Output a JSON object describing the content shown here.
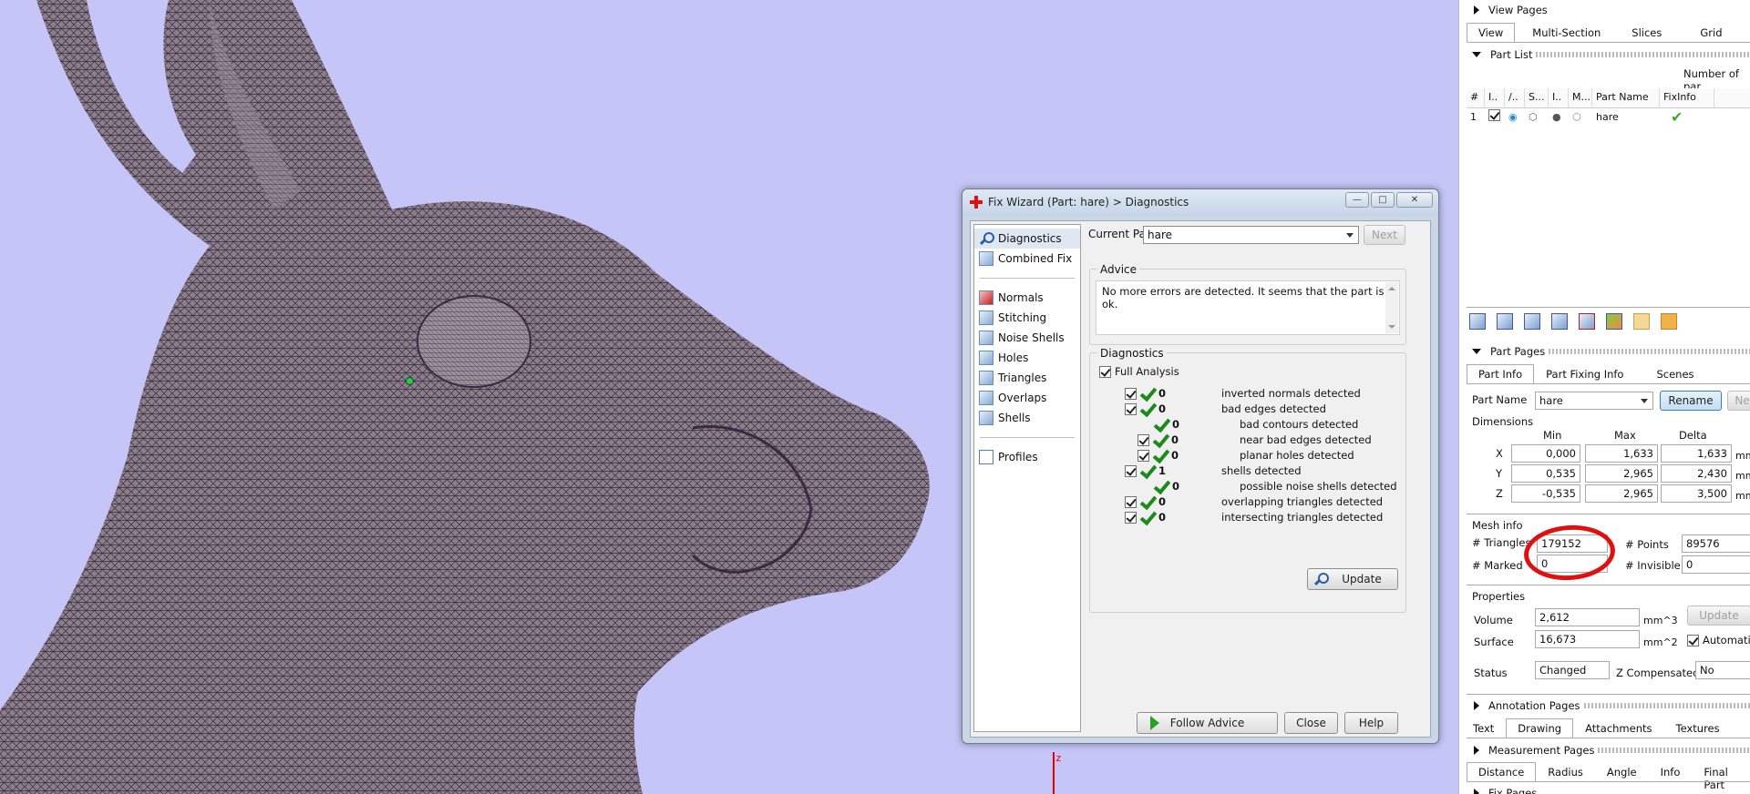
{
  "viewport": {
    "axis_label": "z"
  },
  "fix_wizard": {
    "title": "Fix Wizard (Part: hare) > Diagnostics",
    "window_buttons": {
      "minimize": "—",
      "maximize": "□",
      "close": "✕"
    },
    "nav": {
      "group1": [
        "Diagnostics",
        "Combined Fix"
      ],
      "group2": [
        "Normals",
        "Stitching",
        "Noise Shells",
        "Holes",
        "Triangles",
        "Overlaps",
        "Shells"
      ],
      "group3": [
        "Profiles"
      ]
    },
    "current_part_label": "Current Part:",
    "current_part_value": "hare",
    "next_button": "Next",
    "advice_title": "Advice",
    "advice_text": "No more errors are detected. It seems that the part is ok.",
    "diagnostics_title": "Diagnostics",
    "full_analysis_label": "Full Analysis",
    "diagnostics": [
      {
        "count": "0",
        "label": "inverted normals detected"
      },
      {
        "count": "0",
        "label": "bad edges detected"
      },
      {
        "count": "0",
        "label": "bad contours detected"
      },
      {
        "count": "0",
        "label": "near bad edges detected"
      },
      {
        "count": "0",
        "label": "planar holes detected"
      },
      {
        "count": "1",
        "label": "shells detected"
      },
      {
        "count": "0",
        "label": "possible noise shells detected"
      },
      {
        "count": "0",
        "label": "overlapping triangles detected"
      },
      {
        "count": "0",
        "label": "intersecting triangles detected"
      }
    ],
    "update_button": "Update",
    "follow_advice_button": "Follow Advice",
    "close_button": "Close",
    "help_button": "Help"
  },
  "right_panel": {
    "view_pages": {
      "header": "View Pages",
      "tabs": [
        "View",
        "Multi-Section",
        "Slices",
        "Grid"
      ]
    },
    "part_list": {
      "header": "Part List",
      "number_of_parts_label": "Number of par",
      "columns": [
        "#",
        "I..",
        "/..",
        "S...",
        "I..",
        "M...",
        "Part Name",
        "FixInfo"
      ],
      "row": {
        "index": "1",
        "name": "hare",
        "fixinfo": "✔"
      }
    },
    "part_pages": {
      "header": "Part Pages",
      "tabs": [
        "Part Info",
        "Part Fixing Info",
        "Scenes"
      ],
      "part_name_label": "Part Name",
      "part_name_value": "hare",
      "rename_button": "Rename",
      "next_button": "Nex",
      "dimensions_title": "Dimensions",
      "dim_headers": [
        "Min",
        "Max",
        "Delta"
      ],
      "dims": [
        {
          "axis": "X",
          "min": "0,000",
          "max": "1,633",
          "delta": "1,633",
          "unit": "mm"
        },
        {
          "axis": "Y",
          "min": "0,535",
          "max": "2,965",
          "delta": "2,430",
          "unit": "mm"
        },
        {
          "axis": "Z",
          "min": "-0,535",
          "max": "2,965",
          "delta": "3,500",
          "unit": "mm"
        }
      ],
      "mesh_info_title": "Mesh info",
      "triangles_label": "# Triangles",
      "triangles_value": "179152",
      "points_label": "# Points",
      "points_value": "89576",
      "marked_label": "# Marked",
      "marked_value": "0",
      "invisible_label": "# Invisible",
      "invisible_value": "0",
      "properties_title": "Properties",
      "volume_label": "Volume",
      "volume_value": "2,612",
      "volume_unit": "mm^3",
      "surface_label": "Surface",
      "surface_value": "16,673",
      "surface_unit": "mm^2",
      "update_button": "Update",
      "automatic_label": "Automatic",
      "status_label": "Status",
      "status_value": "Changed",
      "z_comp_label": "Z Compensated",
      "z_comp_value": "No"
    },
    "annotation_pages": {
      "header": "Annotation Pages",
      "tabs": [
        "Text",
        "Drawing",
        "Attachments",
        "Textures"
      ]
    },
    "measurement_pages": {
      "header": "Measurement Pages",
      "tabs": [
        "Distance",
        "Radius",
        "Angle",
        "Info",
        "Final Part"
      ]
    },
    "fix_pages": {
      "header": "Fix Pages"
    }
  }
}
